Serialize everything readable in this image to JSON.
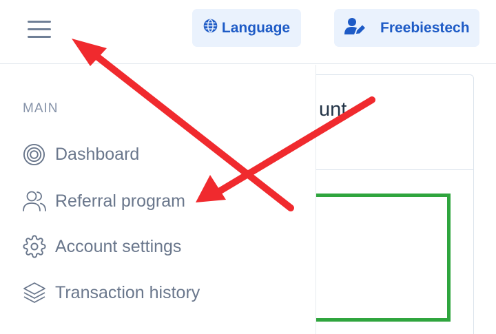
{
  "header": {
    "language_label": "Language",
    "user_name": "Freebiestech"
  },
  "sidebar": {
    "section_label": "MAIN",
    "items": [
      {
        "label": "Dashboard",
        "icon": "target-icon"
      },
      {
        "label": "Referral program",
        "icon": "users-icon"
      },
      {
        "label": "Account settings",
        "icon": "gear-icon"
      },
      {
        "label": "Transaction history",
        "icon": "layers-icon"
      }
    ]
  },
  "main": {
    "card_title_visible": "unt"
  },
  "colors": {
    "accent": "#1e5bc6",
    "button_bg": "#eaf2fd",
    "menu_text": "#6a778c",
    "arrow": "#f02a2e",
    "highlight_box": "#2fa53e"
  }
}
